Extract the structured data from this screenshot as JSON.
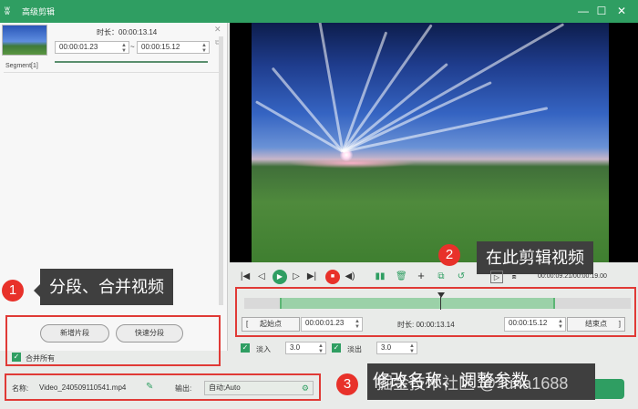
{
  "window": {
    "title": "高级剪辑",
    "min": "—",
    "max": "☐",
    "close": "✕"
  },
  "segment": {
    "label": "Segment[1]",
    "duration_label": "时长：00:00:13.14",
    "start": "00:00:01.23",
    "end": "00:00:15.12",
    "dash": "~",
    "close": "✕"
  },
  "left": {
    "new_segment": "新增片段",
    "quick_split": "快速分段",
    "merge_all": "合并所有"
  },
  "player": {
    "time": "00:00:09.21/00:00:19.00"
  },
  "range": {
    "start_button": "起始点",
    "start": "00:00:01.23",
    "duration": "时长: 00:00:13.14",
    "end": "00:00:15.12",
    "end_button": "结束点",
    "bracket_left": "[",
    "bracket_right": "]"
  },
  "fade": {
    "in_label": "淡入",
    "in_value": "3.0",
    "out_label": "淡出",
    "out_value": "3.0"
  },
  "output": {
    "name_label": "名称:",
    "name": "Video_240509110541.mp4",
    "output_label": "输出:",
    "output_value": "自动;Auto"
  },
  "callouts": {
    "c1": {
      "num": "1",
      "text": "分段、合并视频"
    },
    "c2": {
      "num": "2",
      "text": "在此剪辑视频"
    },
    "c3": {
      "num": "3",
      "text": "修改名称、调整参数"
    }
  },
  "watermark": "掘金技术社区 @ luna1688",
  "colors": {
    "accent": "#2f9e62",
    "callout_red": "#e8312a",
    "box_red": "#e03a36"
  }
}
